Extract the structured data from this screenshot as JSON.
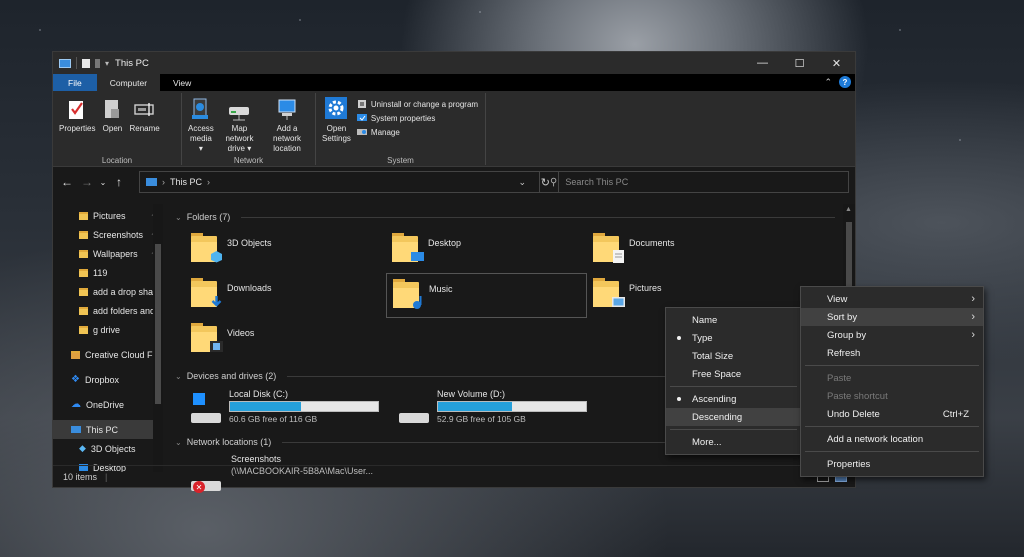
{
  "window": {
    "title": "This PC"
  },
  "tabs": {
    "file": "File",
    "computer": "Computer",
    "view": "View"
  },
  "ribbon": {
    "location": {
      "label": "Location",
      "properties": "Properties",
      "open": "Open",
      "rename": "Rename"
    },
    "network": {
      "label": "Network",
      "access_media_1": "Access",
      "access_media_2": "media ▾",
      "map_drive_1": "Map network",
      "map_drive_2": "drive ▾",
      "add_location_1": "Add a network",
      "add_location_2": "location"
    },
    "system": {
      "label": "System",
      "open_settings_1": "Open",
      "open_settings_2": "Settings",
      "uninstall": "Uninstall or change a program",
      "system_properties": "System properties",
      "manage": "Manage"
    }
  },
  "address": {
    "path": "This PC",
    "search_placeholder": "Search This PC"
  },
  "nav": {
    "items": [
      {
        "label": "Pictures",
        "pinned": true
      },
      {
        "label": "Screenshots",
        "pinned": true
      },
      {
        "label": "Wallpapers",
        "pinned": true
      },
      {
        "label": "119",
        "pinned": false
      },
      {
        "label": "add a drop shad",
        "pinned": false
      },
      {
        "label": "add folders and",
        "pinned": false
      },
      {
        "label": "g drive",
        "pinned": false
      }
    ],
    "creative_cloud": "Creative Cloud File",
    "dropbox": "Dropbox",
    "onedrive": "OneDrive",
    "this_pc": "This PC",
    "objects_3d": "3D Objects",
    "desktop": "Desktop"
  },
  "sections": {
    "folders": "Folders (7)",
    "devices": "Devices and drives (2)",
    "network": "Network locations (1)"
  },
  "folders": [
    "3D Objects",
    "Desktop",
    "Documents",
    "Downloads",
    "Music",
    "Pictures",
    "Videos"
  ],
  "drives": [
    {
      "name": "Local Disk (C:)",
      "free": "60.6 GB free of 116 GB",
      "used_fraction": 0.48
    },
    {
      "name": "New Volume (D:)",
      "free": "52.9 GB free of 105 GB",
      "used_fraction": 0.5
    }
  ],
  "network_location": {
    "name": "Screenshots",
    "path": "(\\\\MACBOOKAIR-5B8A\\Mac\\User..."
  },
  "status": {
    "count": "10 items"
  },
  "context_menu": {
    "view": "View",
    "sort_by": "Sort by",
    "group_by": "Group by",
    "refresh": "Refresh",
    "paste": "Paste",
    "paste_shortcut": "Paste shortcut",
    "undo_delete": "Undo Delete",
    "undo_shortcut": "Ctrl+Z",
    "add_network_location": "Add a network location",
    "properties": "Properties"
  },
  "sort_menu": {
    "name": "Name",
    "type": "Type",
    "total_size": "Total Size",
    "free_space": "Free Space",
    "ascending": "Ascending",
    "descending": "Descending",
    "more": "More..."
  },
  "colors": {
    "accent": "#1d5fa6",
    "drive_fill": "#26a0da",
    "folder": "#f3c75c"
  }
}
